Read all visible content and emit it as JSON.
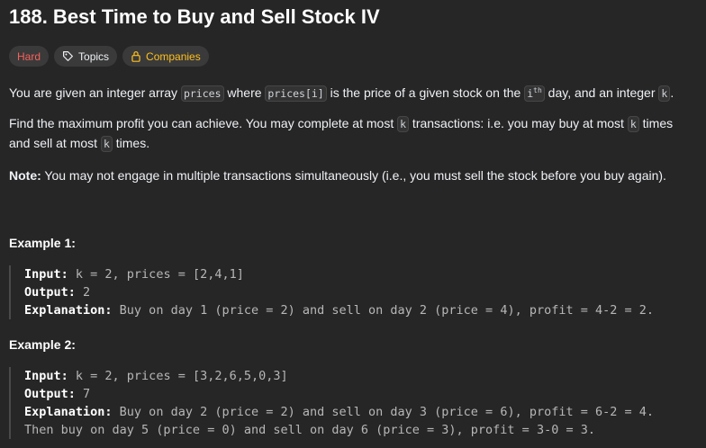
{
  "problem": {
    "title": "188. Best Time to Buy and Sell Stock IV",
    "tags": {
      "difficulty": "Hard",
      "topics": "Topics",
      "companies": "Companies"
    },
    "icons": {
      "topics": "tag-icon",
      "companies": "lock-icon"
    },
    "colors": {
      "hard": "#f8615c",
      "companies": "#ffc01e",
      "background": "#262626"
    }
  },
  "description": {
    "p1": {
      "t1": "You are given an integer array ",
      "c1": "prices",
      "t2": " where ",
      "c2": "prices[i]",
      "t3": " is the price of a given stock on the ",
      "c3": "i",
      "c3sup": "th",
      "t4": " day, and an integer ",
      "c4": "k",
      "t5": "."
    },
    "p2": {
      "t1": "Find the maximum profit you can achieve. You may complete at most ",
      "c1": "k",
      "t2": " transactions: i.e. you may buy at most ",
      "c2": "k",
      "t3": " times and sell at most ",
      "c3": "k",
      "t4": " times."
    },
    "note": {
      "label": "Note:",
      "text": " You may not engage in multiple transactions simultaneously (i.e., you must sell the stock before you buy again)."
    }
  },
  "examples": [
    {
      "title": "Example 1:",
      "input_label": "Input:",
      "input": " k = 2, prices = [2,4,1]",
      "output_label": "Output:",
      "output": " 2",
      "explanation_label": "Explanation:",
      "explanation": " Buy on day 1 (price = 2) and sell on day 2 (price = 4), profit = 4-2 = 2."
    },
    {
      "title": "Example 2:",
      "input_label": "Input:",
      "input": " k = 2, prices = [3,2,6,5,0,3]",
      "output_label": "Output:",
      "output": " 7",
      "explanation_label": "Explanation:",
      "explanation": " Buy on day 2 (price = 2) and sell on day 3 (price = 6), profit = 6-2 = 4.",
      "explanation2": "Then buy on day 5 (price = 0) and sell on day 6 (price = 3), profit = 3-0 = 3."
    }
  ]
}
